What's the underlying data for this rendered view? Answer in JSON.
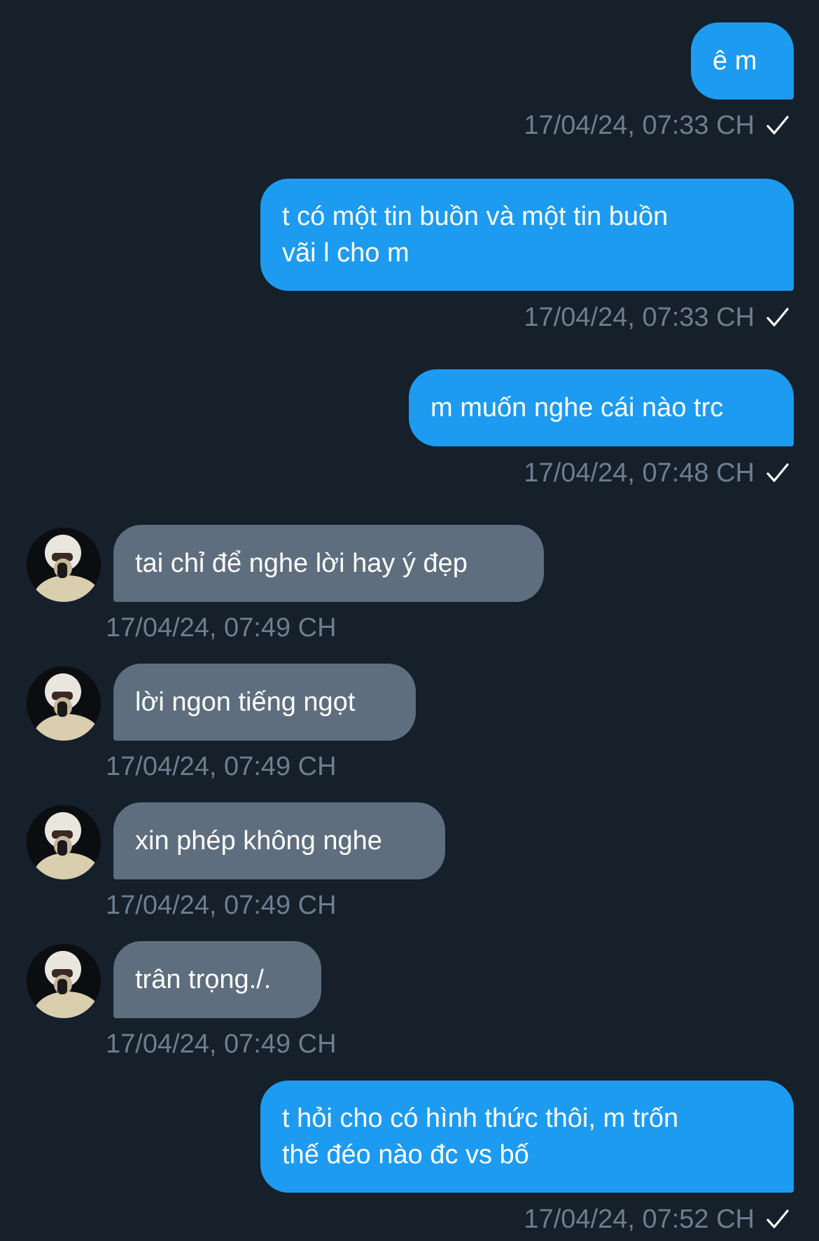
{
  "messages": [
    {
      "direction": "out",
      "text": "ê m",
      "timestamp": "17/04/24, 07:33 CH",
      "status": "check-icon"
    },
    {
      "direction": "out",
      "text": "t có một tin buồn và một tin buồn\nvãi l cho m",
      "timestamp": "17/04/24, 07:33 CH",
      "status": "check-icon"
    },
    {
      "direction": "out",
      "text": "m muốn nghe cái nào trc",
      "timestamp": "17/04/24, 07:48 CH",
      "status": "check-icon"
    },
    {
      "direction": "in",
      "text": "tai chỉ để nghe lời hay ý đẹp",
      "timestamp": "17/04/24, 07:49 CH",
      "avatar": "avatar-icon"
    },
    {
      "direction": "in",
      "text": "lời ngon tiếng ngọt",
      "timestamp": "17/04/24, 07:49 CH",
      "avatar": "avatar-icon"
    },
    {
      "direction": "in",
      "text": "xin phép không nghe",
      "timestamp": "17/04/24, 07:49 CH",
      "avatar": "avatar-icon"
    },
    {
      "direction": "in",
      "text": "trân trọng./.",
      "timestamp": "17/04/24, 07:49 CH",
      "avatar": "avatar-icon"
    },
    {
      "direction": "out",
      "text": "t hỏi cho có hình thức thôi, m trốn\nthế đéo nào đc vs bố",
      "timestamp": "17/04/24, 07:52 CH",
      "status": "check-icon"
    }
  ],
  "colors": {
    "background": "#15202b",
    "outgoing_bubble": "#1d9bf0",
    "incoming_bubble": "#5e6e7e",
    "timestamp": "#6e7e8d",
    "text": "#ffffff"
  }
}
